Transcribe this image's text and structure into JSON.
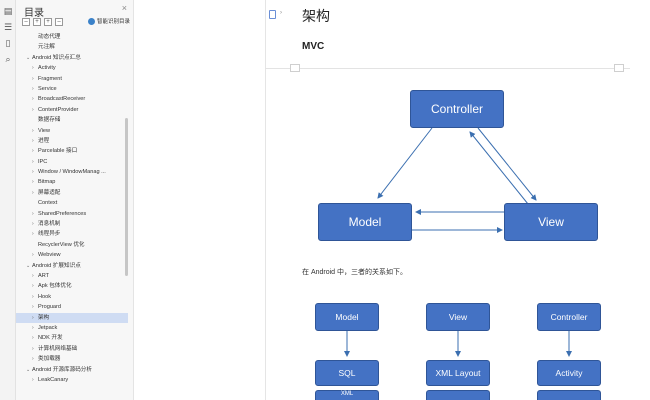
{
  "sidebar": {
    "title": "目录",
    "sync_label": "智能识别目录",
    "items": [
      {
        "label": "动态代理",
        "indent": 2,
        "chevron": ""
      },
      {
        "label": "元注解",
        "indent": 2,
        "chevron": ""
      },
      {
        "label": "Android 知识点汇总",
        "indent": 0,
        "chevron": "v"
      },
      {
        "label": "Activity",
        "indent": 1,
        "chevron": ">"
      },
      {
        "label": "Fragment",
        "indent": 1,
        "chevron": ">"
      },
      {
        "label": "Service",
        "indent": 1,
        "chevron": ">"
      },
      {
        "label": "BroadcastReceiver",
        "indent": 1,
        "chevron": ">"
      },
      {
        "label": "ContentProvider",
        "indent": 1,
        "chevron": ">"
      },
      {
        "label": "数据存储",
        "indent": 2,
        "chevron": ""
      },
      {
        "label": "View",
        "indent": 1,
        "chevron": ">"
      },
      {
        "label": "进程",
        "indent": 1,
        "chevron": ">"
      },
      {
        "label": "Parcelable 接口",
        "indent": 1,
        "chevron": ">"
      },
      {
        "label": "IPC",
        "indent": 1,
        "chevron": ">"
      },
      {
        "label": "Window / WindowManag ...",
        "indent": 1,
        "chevron": ">"
      },
      {
        "label": "Bitmap",
        "indent": 1,
        "chevron": ">"
      },
      {
        "label": "屏幕适配",
        "indent": 1,
        "chevron": ">"
      },
      {
        "label": "Context",
        "indent": 2,
        "chevron": ""
      },
      {
        "label": "SharedPreferences",
        "indent": 1,
        "chevron": ">"
      },
      {
        "label": "消息机制",
        "indent": 1,
        "chevron": ">"
      },
      {
        "label": "线程异步",
        "indent": 1,
        "chevron": ">"
      },
      {
        "label": "RecyclerView 优化",
        "indent": 2,
        "chevron": ""
      },
      {
        "label": "Webview",
        "indent": 1,
        "chevron": ">"
      },
      {
        "label": "Android 扩展知识点",
        "indent": 0,
        "chevron": "v"
      },
      {
        "label": "ART",
        "indent": 1,
        "chevron": ">"
      },
      {
        "label": "Apk 包体优化",
        "indent": 1,
        "chevron": ">"
      },
      {
        "label": "Hook",
        "indent": 1,
        "chevron": ">"
      },
      {
        "label": "Proguard",
        "indent": 1,
        "chevron": ">"
      },
      {
        "label": "架构",
        "indent": 1,
        "chevron": ">",
        "selected": true
      },
      {
        "label": "Jetpack",
        "indent": 1,
        "chevron": ">"
      },
      {
        "label": "NDK 开发",
        "indent": 1,
        "chevron": ">"
      },
      {
        "label": "计算机网络基础",
        "indent": 1,
        "chevron": ">"
      },
      {
        "label": "类加载器",
        "indent": 1,
        "chevron": ">"
      },
      {
        "label": "Android 开源库源码分析",
        "indent": 0,
        "chevron": "v"
      },
      {
        "label": "LeakCanary",
        "indent": 1,
        "chevron": ">"
      }
    ]
  },
  "doc": {
    "title": "架构",
    "subtitle": "MVC",
    "paragraph": "在 Android 中，三者的关系如下。",
    "diagram1": {
      "controller": "Controller",
      "model": "Model",
      "view": "View"
    },
    "diagram2": {
      "model": "Model",
      "view": "View",
      "controller": "Controller",
      "sql": "SQL",
      "xml_layout": "XML Layout",
      "activity": "Activity",
      "partial": "XML"
    }
  },
  "colors": {
    "box_fill": "#4472c4",
    "box_border": "#2f5597",
    "arrow": "#3b6fb0",
    "selection": "#cfdcf3"
  }
}
